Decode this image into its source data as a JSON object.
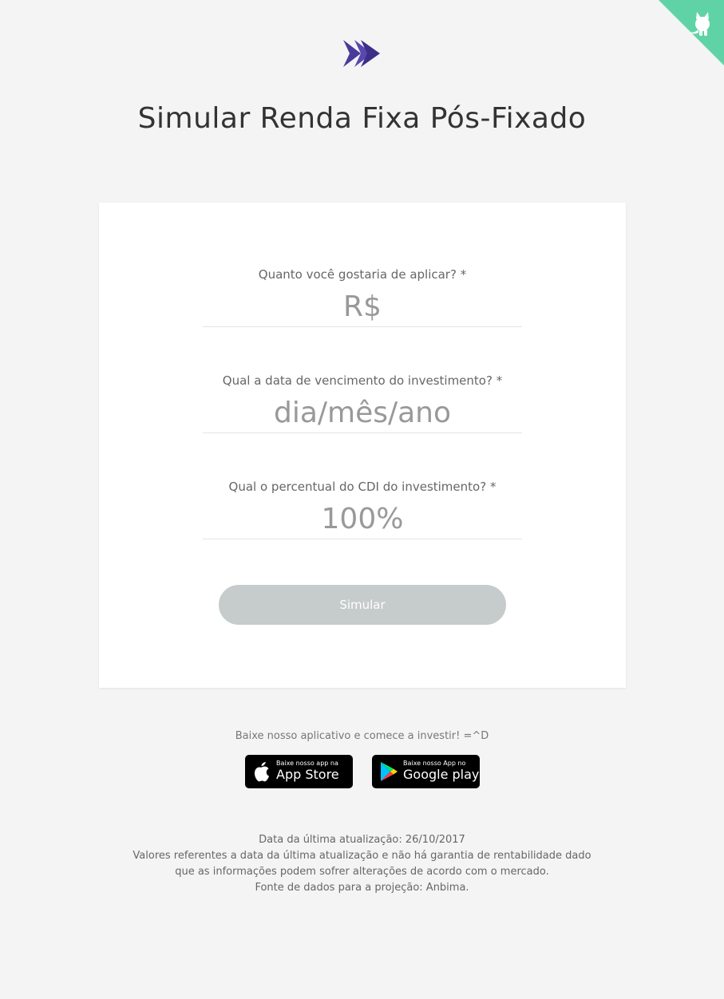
{
  "header": {
    "title": "Simular Renda Fixa Pós-Fixado",
    "logo_icon": "double-chevron-logo",
    "brand_color": "#4a3a9a",
    "corner_color": "#5fd3a6"
  },
  "form": {
    "amount": {
      "label": "Quanto você gostaria de aplicar? *",
      "placeholder": "R$",
      "value": ""
    },
    "maturity": {
      "label": "Qual a data de vencimento do investimento? *",
      "placeholder": "dia/mês/ano",
      "value": ""
    },
    "cdi": {
      "label": "Qual o percentual do CDI do investimento? *",
      "placeholder": "100%",
      "value": ""
    },
    "submit_label": "Simular",
    "submit_color": "#c6cbcb"
  },
  "app_promo": {
    "text": "Baixe nosso aplicativo e comece a investir! =^D",
    "app_store": {
      "small": "Baixe nosso app na",
      "big": "App Store",
      "icon": "apple-icon"
    },
    "google_play": {
      "small": "Baixe nosso App no",
      "big": "Google play",
      "icon": "google-play-icon"
    }
  },
  "footer": {
    "updated": "Data da última atualização: 26/10/2017",
    "disclaimer": "Valores referentes a data da última atualização e não há garantia de rentabilidade dado que as informações podem sofrer alterações de acordo com o mercado.",
    "source": "Fonte de dados para a projeção: Anbima."
  }
}
